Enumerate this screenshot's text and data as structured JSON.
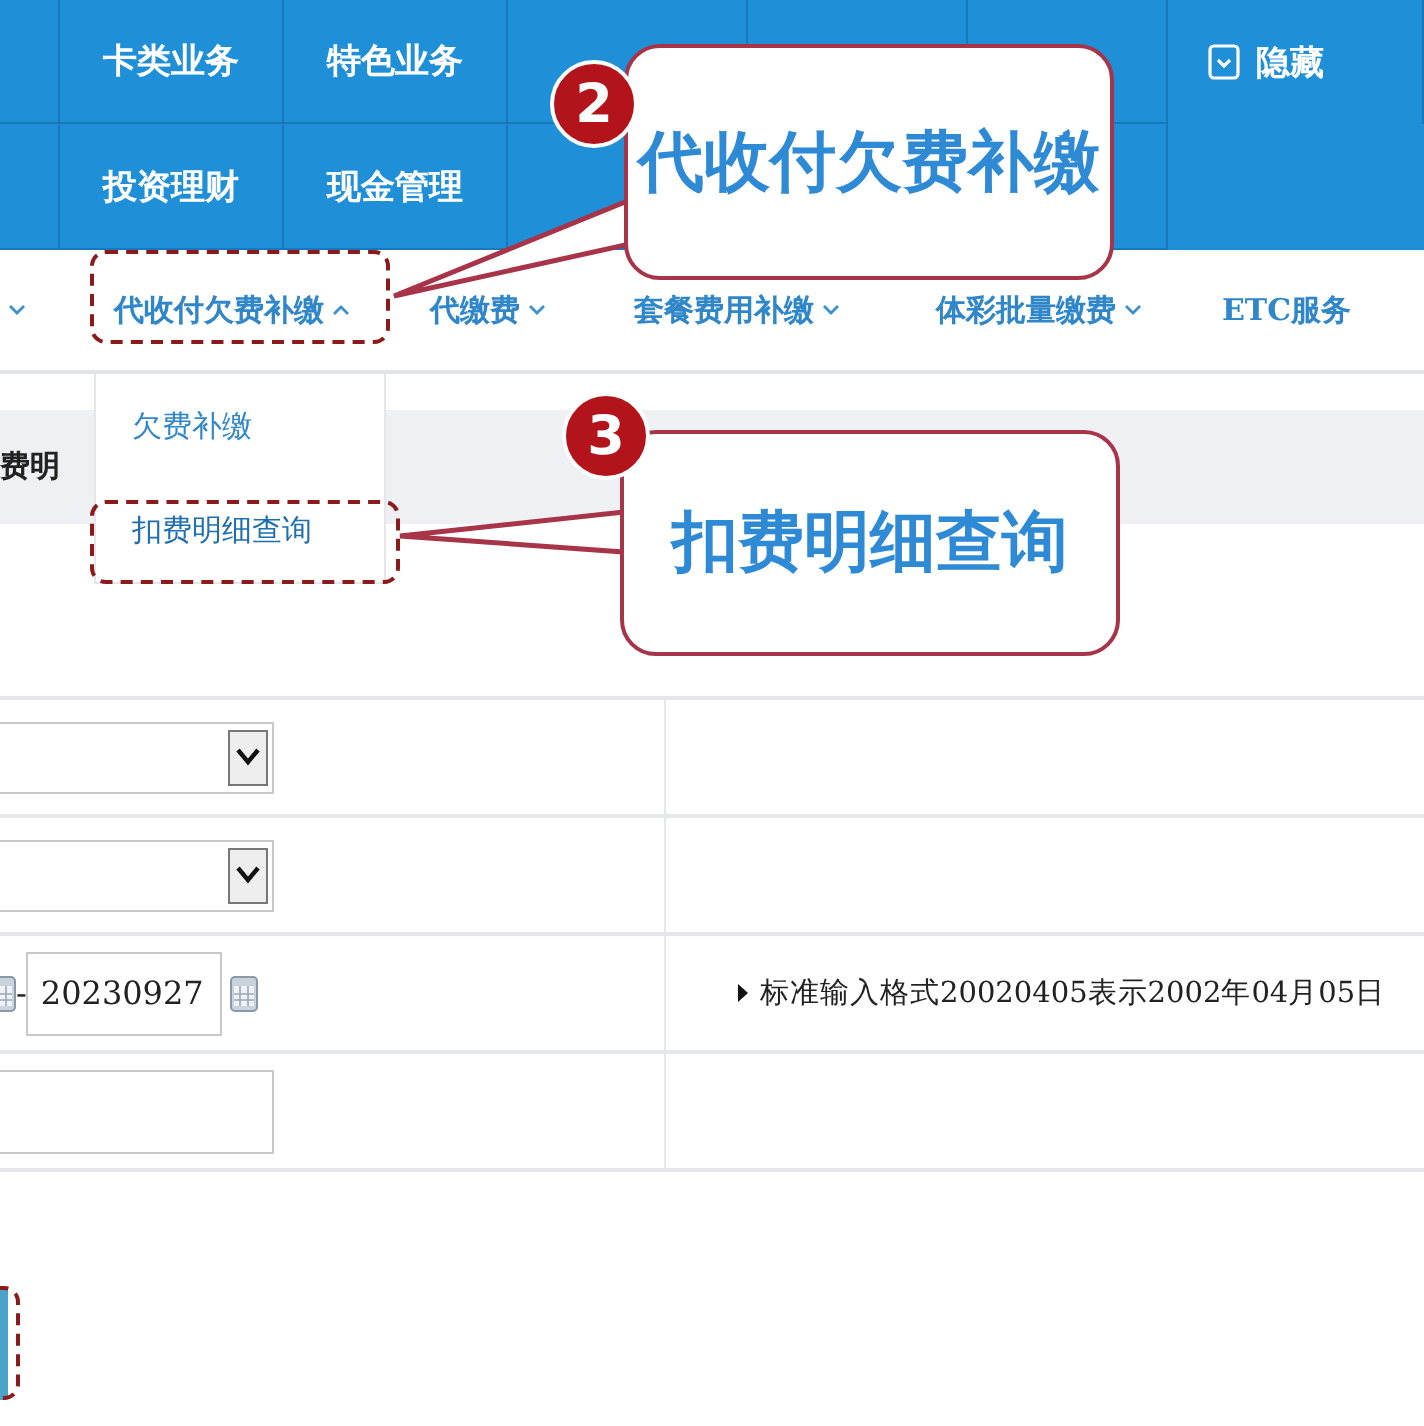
{
  "top_nav": {
    "rows": [
      {
        "items": [
          "卡类业务",
          "特色业务"
        ],
        "toggle": "隐藏"
      },
      {
        "items": [
          "投资理财",
          "现金管理"
        ]
      }
    ]
  },
  "sub_nav": {
    "items": [
      {
        "expanded": false
      },
      {
        "label": "代收付欠费补缴",
        "expanded": true,
        "menu": [
          {
            "label": "欠费补缴",
            "selected": false
          },
          {
            "label": "扣费明细查询",
            "selected": true
          }
        ]
      },
      {
        "label": "代缴费",
        "expanded": false
      },
      {
        "label": "套餐费用补缴",
        "expanded": false
      },
      {
        "label": "体彩批量缴费",
        "expanded": false
      },
      {
        "label": "ETC服务"
      }
    ]
  },
  "breadcrumb": "费明",
  "form": {
    "rows": [
      {
        "kind": "select"
      },
      {
        "kind": "select"
      },
      {
        "kind": "date-range",
        "separator": "-",
        "end_value": "20230927",
        "hint": "标准输入格式20020405表示2002年04月05日"
      },
      {
        "kind": "text"
      }
    ]
  },
  "annotations": {
    "callouts": [
      {
        "number": "2",
        "text": "代收付欠费补缴"
      },
      {
        "number": "3",
        "text": "扣费明细查询"
      }
    ]
  }
}
